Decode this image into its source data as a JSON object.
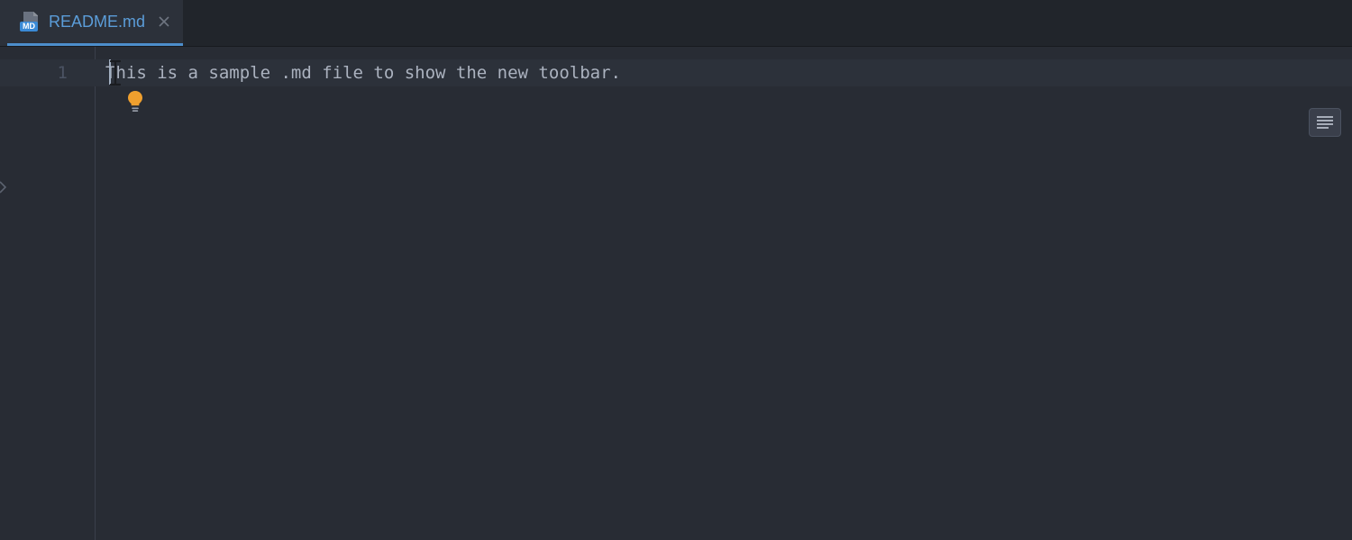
{
  "tab": {
    "icon_badge": "MD",
    "filename": "README.md"
  },
  "editor": {
    "line_number": "1",
    "content": "This is a sample .md file to show the new toolbar."
  }
}
